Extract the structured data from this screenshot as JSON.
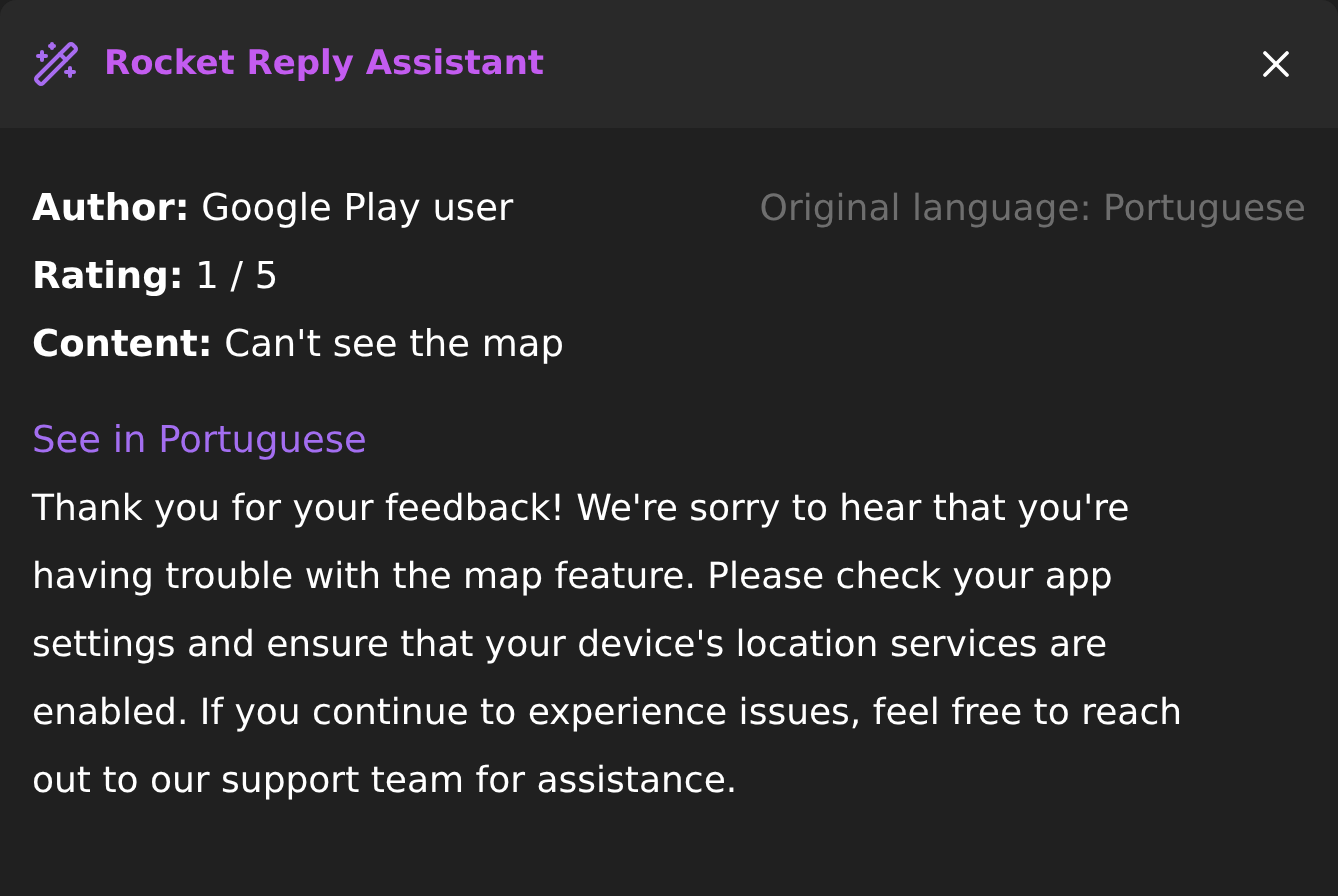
{
  "window": {
    "title": "Rocket Reply Assistant"
  },
  "review": {
    "fields": [
      {
        "label": "Author:",
        "value": "Google Play user"
      },
      {
        "label": "Rating:",
        "value": "1 / 5"
      },
      {
        "label": "Content:",
        "value": "Can't see the map"
      }
    ],
    "original_language": "Original language: Portuguese"
  },
  "translate_link": "See in Portuguese",
  "reply": "Thank you for your feedback! We're sorry to hear that you're having trouble with the map feature. Please check your app settings and ensure that your device's location services are enabled. If you continue to experience issues, feel free to reach out to our support team for assistance."
}
